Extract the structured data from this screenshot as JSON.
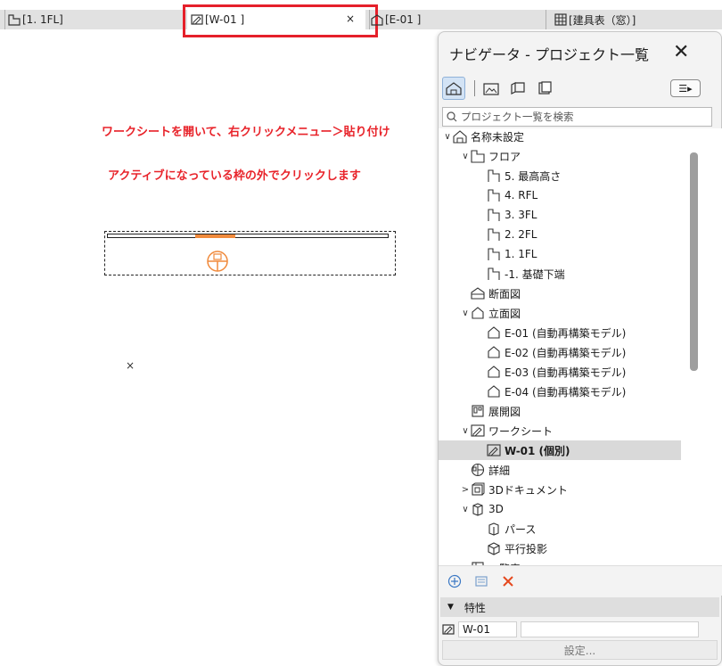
{
  "tabs": {
    "left_partial": "",
    "floor_tab": "[1. 1FL]",
    "active_tab": "[W-01 ]",
    "active_close": "×",
    "elev_tab": "[E-01 ]",
    "schedule_tab": "[建具表（窓）]"
  },
  "annotations": {
    "line1": "ワークシートを開いて、右クリックメニュー＞貼り付け",
    "line2": "アクティブになっている枠の外でクリックします",
    "cursor_mark": "×"
  },
  "navigator": {
    "title": "ナビゲータ - プロジェクト一覧",
    "close": "✕",
    "search_placeholder": "プロジェクト一覧を検索",
    "tree": [
      {
        "label": "名称未設定",
        "chev": "∨",
        "icon": "house-icon",
        "indent": 0
      },
      {
        "label": "フロア",
        "chev": "∨",
        "icon": "floor-icon",
        "indent": 1
      },
      {
        "label": "5. 最高高さ",
        "chev": "",
        "icon": "floor-plan-icon",
        "indent": 2
      },
      {
        "label": "4. RFL",
        "chev": "",
        "icon": "floor-plan-icon",
        "indent": 2
      },
      {
        "label": "3. 3FL",
        "chev": "",
        "icon": "floor-plan-icon",
        "indent": 2
      },
      {
        "label": "2. 2FL",
        "chev": "",
        "icon": "floor-plan-icon",
        "indent": 2
      },
      {
        "label": "1. 1FL",
        "chev": "",
        "icon": "floor-plan-icon",
        "indent": 2
      },
      {
        "label": "-1. 基礎下端",
        "chev": "",
        "icon": "floor-plan-icon",
        "indent": 2
      },
      {
        "label": "断面図",
        "chev": "",
        "icon": "section-icon",
        "indent": 1
      },
      {
        "label": "立面図",
        "chev": "∨",
        "icon": "elevation-icon",
        "indent": 1
      },
      {
        "label": "E-01 (自動再構築モデル)",
        "chev": "",
        "icon": "elevation-icon",
        "indent": 2
      },
      {
        "label": "E-02 (自動再構築モデル)",
        "chev": "",
        "icon": "elevation-icon",
        "indent": 2
      },
      {
        "label": "E-03 (自動再構築モデル)",
        "chev": "",
        "icon": "elevation-icon",
        "indent": 2
      },
      {
        "label": "E-04 (自動再構築モデル)",
        "chev": "",
        "icon": "elevation-icon",
        "indent": 2
      },
      {
        "label": "展開図",
        "chev": "",
        "icon": "interior-elevation-icon",
        "indent": 1
      },
      {
        "label": "ワークシート",
        "chev": "∨",
        "icon": "worksheet-icon",
        "indent": 1
      },
      {
        "label": "W-01 (個別)",
        "chev": "",
        "icon": "worksheet-icon",
        "indent": 2,
        "selected": true
      },
      {
        "label": "詳細",
        "chev": "",
        "icon": "detail-icon",
        "indent": 1
      },
      {
        "label": "3Dドキュメント",
        "chev": ">",
        "icon": "3d-document-icon",
        "indent": 1
      },
      {
        "label": "3D",
        "chev": "∨",
        "icon": "3d-icon",
        "indent": 1
      },
      {
        "label": "パース",
        "chev": "",
        "icon": "perspective-icon",
        "indent": 2
      },
      {
        "label": "平行投影",
        "chev": "",
        "icon": "axonometry-icon",
        "indent": 2
      },
      {
        "label": "一覧表",
        "chev": "",
        "icon": "schedule-icon",
        "indent": 1
      }
    ],
    "properties": {
      "header": "特性",
      "id_value": "W-01",
      "name_value": "",
      "settings_label": "設定..."
    },
    "colors": {
      "accent": "#d3e3f5",
      "annotation": "#e8232a",
      "highlight": "#e5202a",
      "delete": "#e5491f"
    }
  }
}
